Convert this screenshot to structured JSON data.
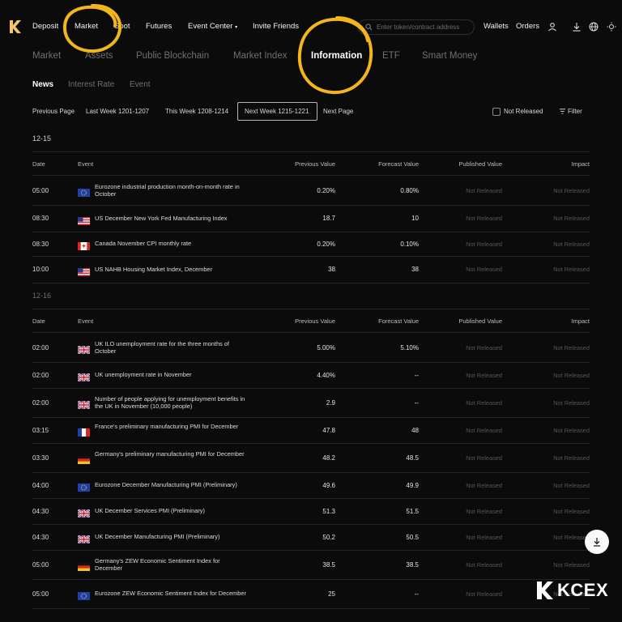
{
  "nav": {
    "items": [
      "Deposit",
      "Market",
      "Spot",
      "Futures",
      "Event Center",
      "Invite Friends"
    ],
    "search_placeholder": "Enter token/contract address",
    "wallets": "Wallets",
    "orders": "Orders"
  },
  "subtabs": [
    "Market",
    "Assets",
    "Public Blockchain",
    "Market Index",
    "Information",
    "ETF",
    "Smart Money"
  ],
  "categories": [
    "News",
    "Interest Rate",
    "Event"
  ],
  "weeknav": {
    "prev_page": "Previous Page",
    "last_week": "Last Week 1201-1207",
    "this_week": "This Week 1208-1214",
    "next_week": "Next Week 1215-1221",
    "next_page": "Next Page"
  },
  "controls": {
    "not_released": "Not Released",
    "filter": "Filter"
  },
  "headers": {
    "date": "Date",
    "event": "Event",
    "previous": "Previous Value",
    "forecast": "Forecast Value",
    "published": "Published Value",
    "impact": "Impact"
  },
  "groups": [
    {
      "date": "12-15",
      "rows": [
        {
          "time": "05:00",
          "flag": "eu",
          "event": "Eurozone industrial production month-on-month rate in October",
          "prev": "0.20%",
          "fc": "0.80%",
          "pub": "Not Released",
          "imp": "Not Released"
        },
        {
          "time": "08:30",
          "flag": "us",
          "event": "US December New York Fed Manufacturing Index",
          "prev": "18.7",
          "fc": "10",
          "pub": "Not Released",
          "imp": "Not Released"
        },
        {
          "time": "08:30",
          "flag": "ca",
          "event": "Canada November CPI monthly rate",
          "prev": "0.20%",
          "fc": "0.10%",
          "pub": "Not Released",
          "imp": "Not Released"
        },
        {
          "time": "10:00",
          "flag": "us",
          "event": "US NAHB Housing Market Index, December",
          "prev": "38",
          "fc": "38",
          "pub": "Not Released",
          "imp": "Not Released"
        }
      ]
    },
    {
      "date": "12-16",
      "rows": [
        {
          "time": "02:00",
          "flag": "uk",
          "event": "UK ILO unemployment rate for the three months of October",
          "prev": "5.00%",
          "fc": "5.10%",
          "pub": "Not Released",
          "imp": "Not Released"
        },
        {
          "time": "02:00",
          "flag": "uk",
          "event": "UK unemployment rate in November",
          "prev": "4.40%",
          "fc": "--",
          "pub": "Not Released",
          "imp": "Not Released"
        },
        {
          "time": "02:00",
          "flag": "uk",
          "event": "Number of people applying for unemployment benefits in the UK in November (10,000 people)",
          "prev": "2.9",
          "fc": "--",
          "pub": "Not Released",
          "imp": "Not Released"
        },
        {
          "time": "03:15",
          "flag": "fr",
          "event": "France's preliminary manufacturing PMI for December",
          "prev": "47.8",
          "fc": "48",
          "pub": "Not Released",
          "imp": "Not Released"
        },
        {
          "time": "03:30",
          "flag": "de",
          "event": "Germany's preliminary manufacturing PMI for December",
          "prev": "48.2",
          "fc": "48.5",
          "pub": "Not Released",
          "imp": "Not Released"
        },
        {
          "time": "04:00",
          "flag": "eu",
          "event": "Eurozone December Manufacturing PMI (Preliminary)",
          "prev": "49.6",
          "fc": "49.9",
          "pub": "Not Released",
          "imp": "Not Released"
        },
        {
          "time": "04:30",
          "flag": "uk",
          "event": "UK December Services PMI (Preliminary)",
          "prev": "51.3",
          "fc": "51.5",
          "pub": "Not Released",
          "imp": "Not Released"
        },
        {
          "time": "04:30",
          "flag": "uk",
          "event": "UK December Manufacturing PMI (Preliminary)",
          "prev": "50.2",
          "fc": "50.5",
          "pub": "Not Released",
          "imp": "Not Released"
        },
        {
          "time": "05:00",
          "flag": "de",
          "event": "Germany's ZEW Economic Sentiment Index for December",
          "prev": "38.5",
          "fc": "38.5",
          "pub": "Not Released",
          "imp": "Not Released"
        },
        {
          "time": "05:00",
          "flag": "eu",
          "event": "Eurozone ZEW Economic Sentiment Index for December",
          "prev": "25",
          "fc": "--",
          "pub": "Not Released",
          "imp": "Not Released"
        }
      ]
    }
  ],
  "brand": "KCEX",
  "colors": {
    "accent_circle": "#f2b51c",
    "background": "#0b0b0c"
  }
}
